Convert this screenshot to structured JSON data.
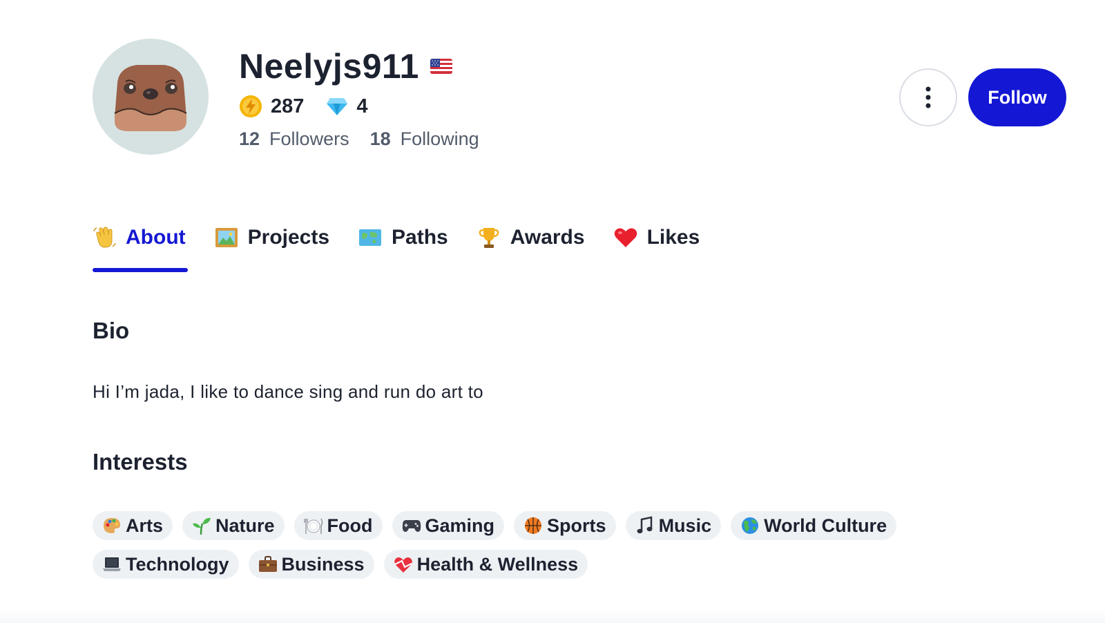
{
  "profile": {
    "username": "Neelyjs911",
    "country_flag": "us-flag-icon",
    "coins": "287",
    "gems": "4",
    "followers_count": "12",
    "followers_label": "Followers",
    "following_count": "18",
    "following_label": "Following"
  },
  "actions": {
    "follow_label": "Follow",
    "more_icon": "vertical-ellipsis-icon"
  },
  "tabs": [
    {
      "label": "About",
      "icon": "waving-hand-icon",
      "active": true
    },
    {
      "label": "Projects",
      "icon": "framed-picture-icon",
      "active": false
    },
    {
      "label": "Paths",
      "icon": "world-map-icon",
      "active": false
    },
    {
      "label": "Awards",
      "icon": "trophy-icon",
      "active": false
    },
    {
      "label": "Likes",
      "icon": "heart-icon",
      "active": false
    }
  ],
  "bio": {
    "title": "Bio",
    "text": "Hi I’m jada, I like to dance sing and run do art to"
  },
  "interests": {
    "title": "Interests",
    "items": [
      {
        "label": "Arts",
        "icon": "palette-icon"
      },
      {
        "label": "Nature",
        "icon": "seedling-icon"
      },
      {
        "label": "Food",
        "icon": "plate-icon"
      },
      {
        "label": "Gaming",
        "icon": "game-controller-icon"
      },
      {
        "label": "Sports",
        "icon": "basketball-icon"
      },
      {
        "label": "Music",
        "icon": "music-note-icon"
      },
      {
        "label": "World Culture",
        "icon": "globe-icon"
      },
      {
        "label": "Technology",
        "icon": "laptop-icon"
      },
      {
        "label": "Business",
        "icon": "briefcase-icon"
      },
      {
        "label": "Health & Wellness",
        "icon": "heart-ribbon-icon"
      }
    ]
  },
  "colors": {
    "accent": "#1418d4",
    "text": "#1d2230",
    "muted": "#525c6b",
    "chip_bg": "#eef1f4",
    "avatar_bg": "#d6e2e2"
  }
}
